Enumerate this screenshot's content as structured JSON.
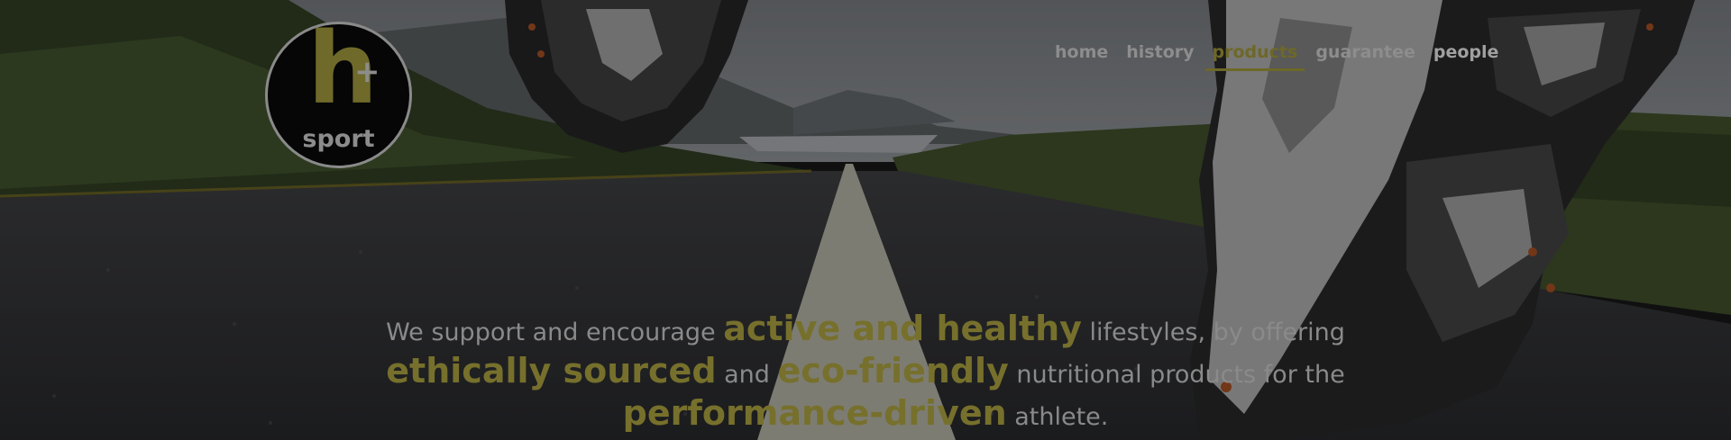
{
  "logo": {
    "letter": "h",
    "plus": "+",
    "word": "sport"
  },
  "nav": {
    "items": [
      {
        "label": "home"
      },
      {
        "label": "history"
      },
      {
        "label": "products"
      },
      {
        "label": "guarantee"
      },
      {
        "label": "people"
      }
    ],
    "active_index": 2
  },
  "tagline": {
    "part1": "We support and encourage",
    "hl1": "active and healthy",
    "part2": "lifestyles, by offering",
    "hl2": "ethically sourced",
    "part3": "and",
    "hl3": "eco-friendly",
    "part4": "nutritional products for the",
    "hl4": "performance-driven",
    "part5": "athlete."
  },
  "colors": {
    "accent": "#6e6828",
    "nav_text": "#8d8d8d",
    "overlay": "rgba(0,0,0,0.42)"
  },
  "background": {
    "description_icon": "running-shoes-road-photo"
  }
}
